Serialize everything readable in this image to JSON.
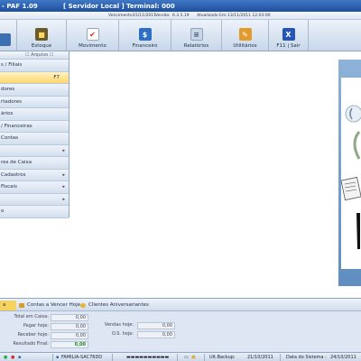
{
  "titlebar": {
    "app": "- PAF 1.09",
    "mode": "[ Servidor Local ]",
    "terminal": "Terminal: 000"
  },
  "info": {
    "vencimento_label": "Vencimento:",
    "vencimento": "15/11/2011",
    "versao_label": "Versão:",
    "versao": "6.3.5.19",
    "atualizado_label": "Atualizado Em:",
    "atualizado": "13/11/2011 12:03:00"
  },
  "toolbar": {
    "items": [
      {
        "label": "",
        "icon": "partial-icon"
      },
      {
        "label": "Estoque",
        "icon": "stock-box-icon"
      },
      {
        "label": "Movimento",
        "icon": "checkmark-doc-icon"
      },
      {
        "label": "Financeiro",
        "icon": "calculator-icon"
      },
      {
        "label": "Relatórios",
        "icon": "report-list-icon"
      },
      {
        "label": "Utilitários",
        "icon": "tools-icon"
      },
      {
        "label": "F11 | Sair",
        "icon": "exit-x-icon"
      }
    ]
  },
  "leftmenu": {
    "header": "☐ Arquivo ☐",
    "items": [
      {
        "label": "s / Filiais",
        "arrow": "",
        "hotkey": ""
      },
      {
        "label": "",
        "arrow": "",
        "hotkey": "F7"
      },
      {
        "label": "dores",
        "arrow": "",
        "hotkey": ""
      },
      {
        "label": "rtadores",
        "arrow": "",
        "hotkey": ""
      },
      {
        "label": "ários",
        "arrow": "",
        "hotkey": ""
      },
      {
        "label": "/ Financeiras",
        "arrow": "",
        "hotkey": ""
      },
      {
        "label": "Contas",
        "arrow": "",
        "hotkey": ""
      },
      {
        "label": "",
        "arrow": "▸",
        "hotkey": ""
      },
      {
        "label": "res de Caixa",
        "arrow": "",
        "hotkey": ""
      },
      {
        "label": "Cadastros",
        "arrow": "▸",
        "hotkey": ""
      },
      {
        "label": "Fiscais",
        "arrow": "▸",
        "hotkey": ""
      },
      {
        "label": "",
        "arrow": "▸",
        "hotkey": ""
      },
      {
        "label": "o",
        "arrow": "",
        "hotkey": ""
      }
    ]
  },
  "bottom": {
    "tabs": [
      {
        "label": "a"
      },
      {
        "label": "Contas a Vencer Hoje"
      },
      {
        "label": "Clientes Aniversariantes"
      }
    ],
    "left_fields": [
      {
        "label": "Total em Caixa:",
        "value": "0,00"
      },
      {
        "label": "Pagar hoje:",
        "value": "0,00"
      },
      {
        "label": "Receber hoje:",
        "value": "0,00"
      },
      {
        "label": "Resultado Final:",
        "value": "0,00"
      }
    ],
    "right_fields": [
      {
        "label": "Vendas hoje:",
        "value": "0,00"
      },
      {
        "label": "O.S. hoje:",
        "value": "0,00"
      }
    ]
  },
  "statusbar": {
    "computer": "FAMILIA-SAC76DD",
    "user_redacted": "▬▬▬▬▬▬▬▬▬▬",
    "backup_label": "Ult.Backup:",
    "backup": "21/10/2011",
    "sistema_label": "Data do Sistema :",
    "sistema": "24/10/2011"
  }
}
